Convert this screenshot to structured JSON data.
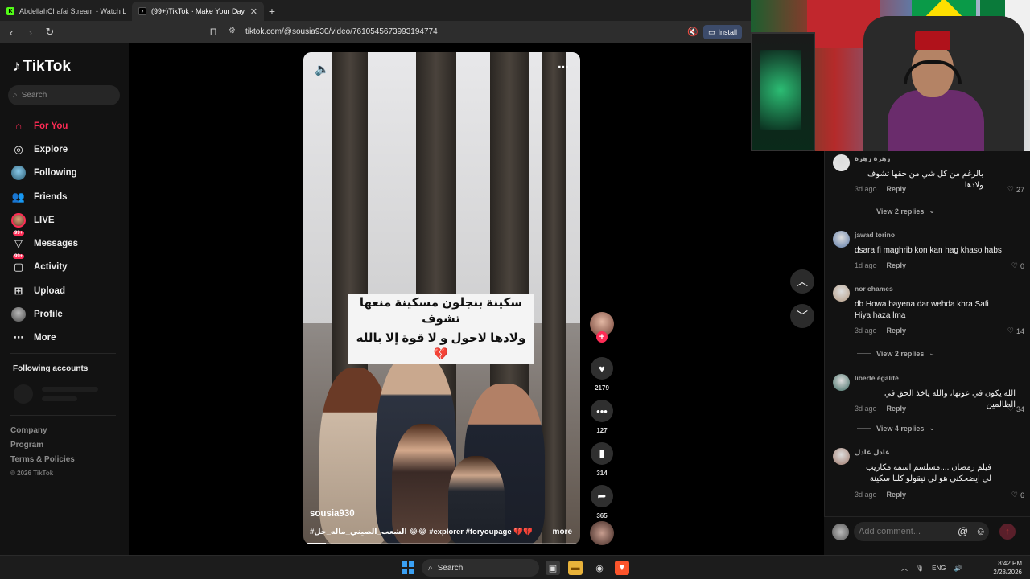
{
  "browser": {
    "tabs": [
      {
        "title": "AbdellahChafai Stream - Watch Live",
        "icon": "kick-icon"
      },
      {
        "title": "(99+)TikTok - Make Your Day",
        "icon": "tiktok-icon"
      }
    ],
    "new_tab": "+",
    "url": "tiktok.com/@sousia930/video/7610545673993194774",
    "install_label": "Install"
  },
  "sidebar": {
    "logo": "TikTok",
    "search_placeholder": "Search",
    "nav": [
      {
        "label": "For You",
        "icon": "home-icon"
      },
      {
        "label": "Explore",
        "icon": "compass-icon"
      },
      {
        "label": "Following",
        "icon": "following-avatar"
      },
      {
        "label": "Friends",
        "icon": "friends-icon"
      },
      {
        "label": "LIVE",
        "icon": "live-avatar"
      },
      {
        "label": "Messages",
        "icon": "messages-icon",
        "badge": "99+"
      },
      {
        "label": "Activity",
        "icon": "activity-icon",
        "badge": "99+"
      },
      {
        "label": "Upload",
        "icon": "upload-icon"
      },
      {
        "label": "Profile",
        "icon": "profile-avatar"
      },
      {
        "label": "More",
        "icon": "more-icon"
      }
    ],
    "following_accounts_title": "Following accounts",
    "footer": {
      "company": "Company",
      "program": "Program",
      "terms": "Terms & Policies",
      "copyright": "© 2026 TikTok"
    }
  },
  "video": {
    "caption_line1": "سكينة بنجلون مسكينة منعها تشوف",
    "caption_line2": "ولادها لاحول و لا قوة إلا بالله 💔",
    "author": "sousia930",
    "description": "#الشعب_الصيني_ماله_حل 😂😂 #explorer #foryoupage 💔💔 ...",
    "more_label": "more",
    "progress": 0.08
  },
  "actions": {
    "likes": "2179",
    "comments": "127",
    "saves": "314",
    "shares": "365"
  },
  "comments": [
    {
      "user": "زهرة زهرة",
      "text": "بالرغم من كل شي من حقها تشوف ولادها",
      "rtl": true,
      "age": "3d ago",
      "likes": "27",
      "replies": "View 2 replies",
      "avatar": "#e6e6e6"
    },
    {
      "user": "jawad torino",
      "text": "dsara fi maghrib kon kan hag khaso habs",
      "rtl": false,
      "age": "1d ago",
      "likes": "0",
      "replies": "",
      "avatar": "#5b7aa8"
    },
    {
      "user": "nor chames",
      "text": "db Howa bayena dar wehda khra Safi Hiya haza lma",
      "rtl": false,
      "age": "3d ago",
      "likes": "14",
      "replies": "View 2 replies",
      "avatar": "#b59c84"
    },
    {
      "user": "liberté égalité",
      "text": "الله يكون في عونها، والله ياخذ الحق في الظالمين",
      "rtl": true,
      "age": "3d ago",
      "likes": "34",
      "replies": "View 4 replies",
      "avatar": "#3e6b62"
    },
    {
      "user": "عادل عادل",
      "text": "فيلم رمضان ....مسلسم اسمه مكاريب لي ايضحكني هو لي تيقولو كلنا سكينة",
      "rtl": true,
      "age": "3d ago",
      "likes": "6",
      "replies": "",
      "avatar": "#a07a6c"
    }
  ],
  "comment_reply_label": "Reply",
  "add_comment_placeholder": "Add comment...",
  "taskbar": {
    "search_label": "Search",
    "lang": "ENG",
    "time": "8:42 PM",
    "date": "2/28/2026"
  },
  "colors": {
    "accent": "#fe2c55",
    "sidebar_bg": "#121212"
  }
}
